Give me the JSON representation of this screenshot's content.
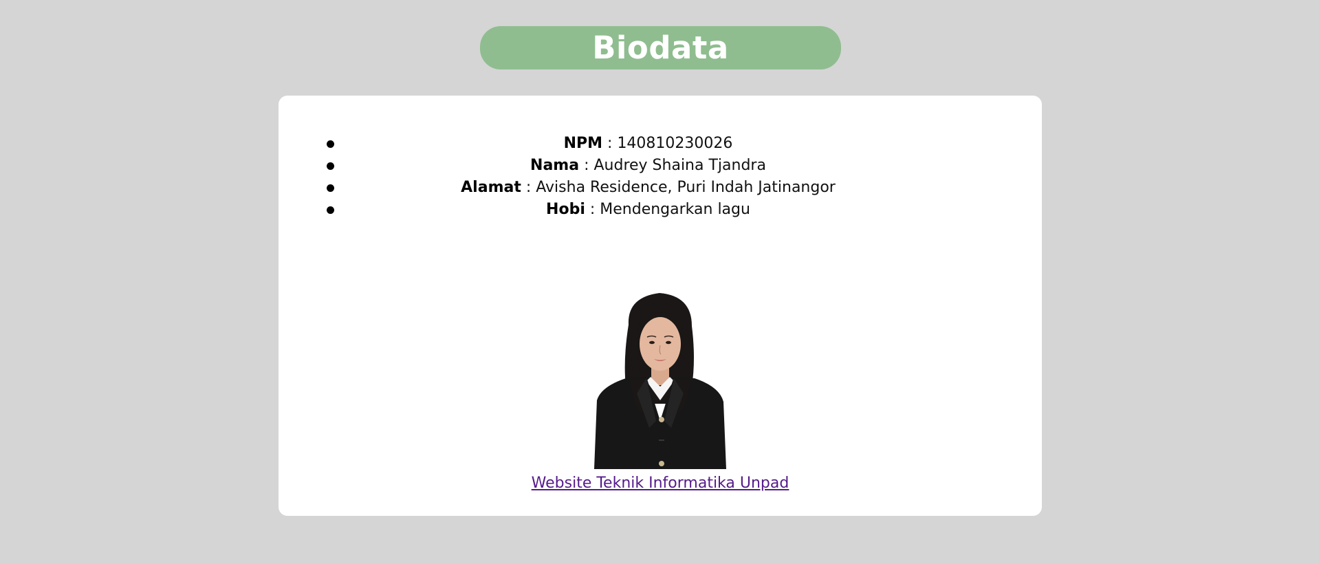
{
  "header": {
    "title": "Biodata",
    "pill_color": "#8fbd8f"
  },
  "biodata": {
    "items": [
      {
        "label": "NPM",
        "separator": " : ",
        "value": "140810230026"
      },
      {
        "label": "Nama",
        "separator": " : ",
        "value": "Audrey Shaina Tjandra"
      },
      {
        "label": "Alamat",
        "separator": " : ",
        "value": "Avisha Residence, Puri Indah Jatinangor"
      },
      {
        "label": "Hobi",
        "separator": " : ",
        "value": "Mendengarkan lagu"
      }
    ]
  },
  "photo": {
    "icon": "profile-photo"
  },
  "footer": {
    "link_text": "Website Teknik Informatika Unpad",
    "link_color": "#551a8b"
  },
  "colors": {
    "page_background": "#d5d5d5",
    "card_background": "#ffffff"
  }
}
